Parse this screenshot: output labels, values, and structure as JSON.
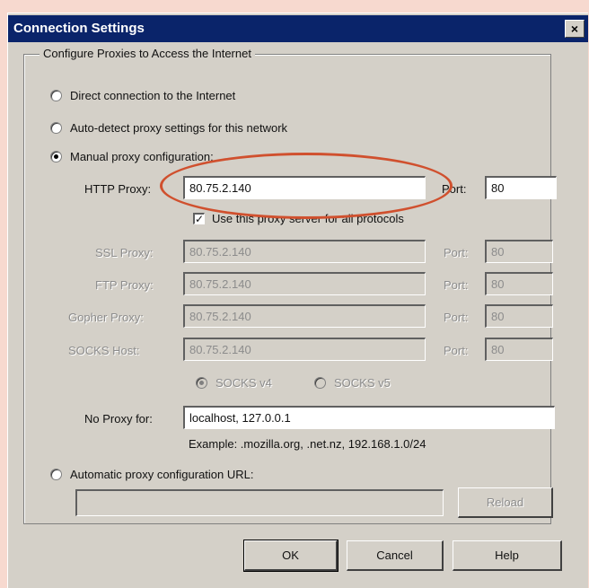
{
  "window": {
    "title": "Connection Settings",
    "close_glyph": "×"
  },
  "group": {
    "legend": "Configure Proxies to Access the Internet"
  },
  "options": {
    "direct": "Direct connection to the Internet",
    "auto_detect": "Auto-detect proxy settings for this network",
    "manual": "Manual proxy configuration:",
    "auto_url": "Automatic proxy configuration URL:"
  },
  "http": {
    "label": "HTTP Proxy:",
    "value": "80.75.2.140",
    "port_label": "Port:",
    "port_value": "80"
  },
  "use_same": {
    "label": "Use this proxy server for all protocols",
    "checked": true,
    "check_glyph": "✓"
  },
  "ssl": {
    "label": "SSL Proxy:",
    "value": "80.75.2.140",
    "port_label": "Port:",
    "port_value": "80"
  },
  "ftp": {
    "label": "FTP Proxy:",
    "value": "80.75.2.140",
    "port_label": "Port:",
    "port_value": "80"
  },
  "gopher": {
    "label": "Gopher Proxy:",
    "value": "80.75.2.140",
    "port_label": "Port:",
    "port_value": "80"
  },
  "socks": {
    "label": "SOCKS Host:",
    "value": "80.75.2.140",
    "port_label": "Port:",
    "port_value": "80"
  },
  "socks_version": {
    "v4": "SOCKS v4",
    "v5": "SOCKS v5"
  },
  "no_proxy": {
    "label": "No Proxy for:",
    "value": "localhost, 127.0.0.1",
    "example": "Example: .mozilla.org, .net.nz, 192.168.1.0/24"
  },
  "auto_url": {
    "value": "",
    "reload": "Reload"
  },
  "buttons": {
    "ok": "OK",
    "cancel": "Cancel",
    "help": "Help"
  },
  "colors": {
    "titlebar": "#0a246a",
    "dialog": "#d4d0c8",
    "annotation": "#d0502e",
    "backdrop": "#f7d9cf"
  }
}
